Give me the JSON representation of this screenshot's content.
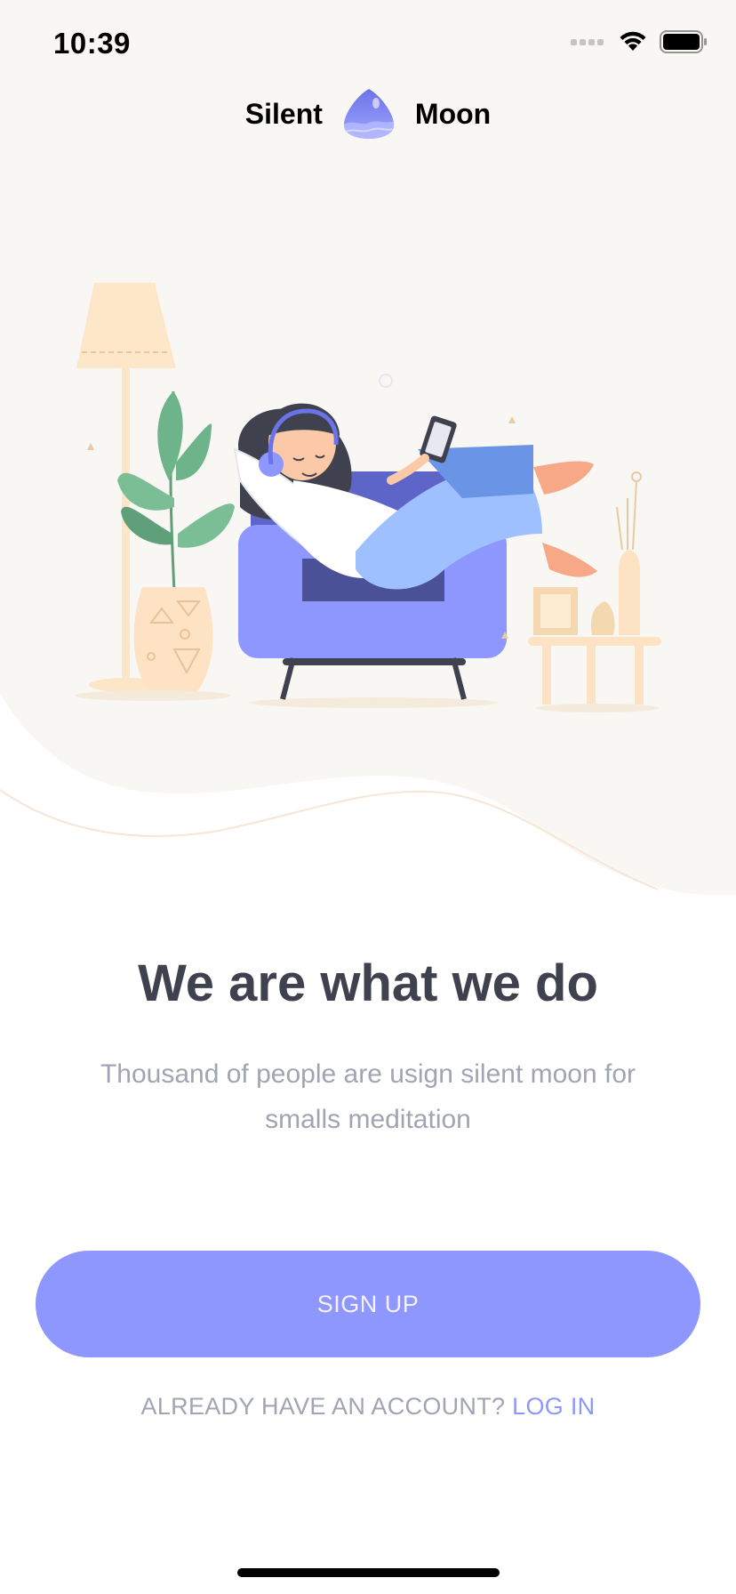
{
  "status_bar": {
    "time": "10:39"
  },
  "brand": {
    "left_word": "Silent",
    "right_word": "Moon"
  },
  "hero": {
    "illustration": "woman-relaxing-in-armchair-with-headphones"
  },
  "content": {
    "headline": "We are what we do",
    "subtitle": "Thousand of people are usign silent moon for smalls meditation"
  },
  "actions": {
    "signup_label": "SIGN UP",
    "login_prompt": "ALREADY HAVE AN ACCOUNT?",
    "login_link": "LOG IN"
  },
  "colors": {
    "accent": "#8E97FD",
    "heading": "#3F414E",
    "muted": "#A1A4B2",
    "hero_background": "#F9F7F4"
  }
}
